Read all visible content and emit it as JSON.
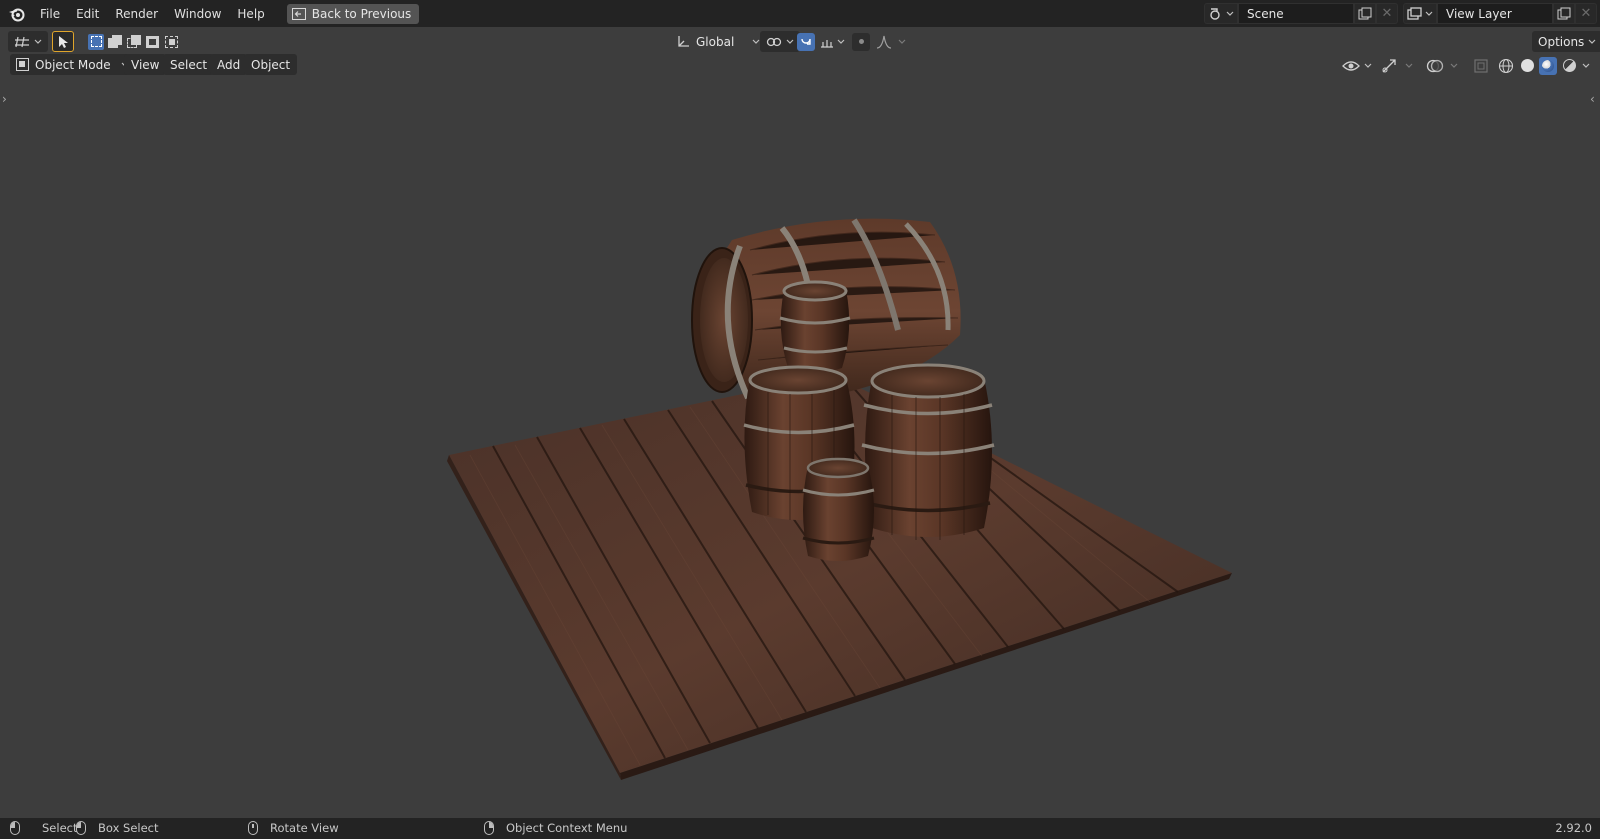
{
  "topbar": {
    "logo_icon": "blender-logo-icon",
    "menus": [
      "File",
      "Edit",
      "Render",
      "Window",
      "Help"
    ],
    "back_button": "Back to Previous",
    "scene": "Scene",
    "view_layer": "View Layer"
  },
  "toolheader": {
    "transform_orientation": "Global",
    "options": "Options"
  },
  "viewport_header": {
    "mode": "Object Mode",
    "menus": [
      "View",
      "Select",
      "Add",
      "Object"
    ]
  },
  "status": {
    "select": "Select",
    "box_select": "Box Select",
    "rotate_view": "Rotate View",
    "context_menu": "Object Context Menu",
    "version": "2.92.0"
  },
  "colors": {
    "topbar_bg": "#232323",
    "viewport_bg": "#3d3d3d",
    "accent_blue": "#4772b3",
    "tool_highlight": "#e0a52b",
    "wood_dark": "#3f2a22",
    "wood_mid": "#5a3a2c",
    "metal_band": "#8a8278"
  }
}
